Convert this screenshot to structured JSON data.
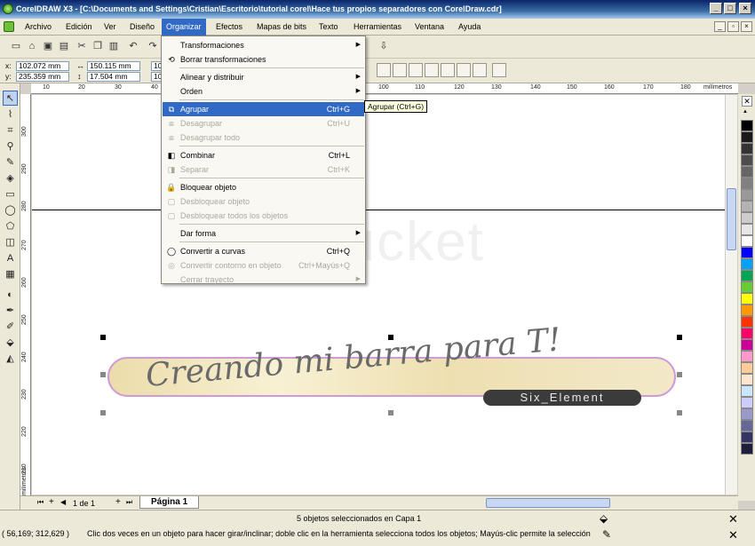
{
  "window": {
    "title": "CorelDRAW X3 - [C:\\Documents and Settings\\Cristian\\Escritorio\\tutorial corel\\Hace tus propios separadores con CorelDraw.cdr]",
    "minimize": "_",
    "maximize": "□",
    "close": "×"
  },
  "menubar": {
    "items": [
      "Archivo",
      "Edición",
      "Ver",
      "Diseño",
      "Organizar",
      "Efectos",
      "Mapas de bits",
      "Texto",
      "Herramientas",
      "Ventana",
      "Ayuda"
    ],
    "active": "Organizar"
  },
  "propbar": {
    "x_label": "x:",
    "x_value": "102.072 mm",
    "y_label": "y:",
    "y_value": "235.359 mm",
    "w_value": "150.115 mm",
    "h_value": "17.504 mm",
    "scale_x": "10",
    "scale_y": "10"
  },
  "organizar_menu": {
    "items": [
      {
        "label": "Transformaciones",
        "shortcut": "",
        "submenu": true,
        "disabled": false,
        "highlighted": false,
        "icon": ""
      },
      {
        "label": "Borrar transformaciones",
        "shortcut": "",
        "submenu": false,
        "disabled": false,
        "highlighted": false,
        "icon": "clear-transform-icon"
      },
      {
        "label": "Alinear y distribuir",
        "shortcut": "",
        "submenu": true,
        "disabled": false,
        "highlighted": false,
        "icon": ""
      },
      {
        "label": "Orden",
        "shortcut": "",
        "submenu": true,
        "disabled": false,
        "highlighted": false,
        "icon": ""
      },
      {
        "label": "Agrupar",
        "shortcut": "Ctrl+G",
        "submenu": false,
        "disabled": false,
        "highlighted": true,
        "icon": "group-icon"
      },
      {
        "label": "Desagrupar",
        "shortcut": "Ctrl+U",
        "submenu": false,
        "disabled": true,
        "highlighted": false,
        "icon": "ungroup-icon"
      },
      {
        "label": "Desagrupar todo",
        "shortcut": "",
        "submenu": false,
        "disabled": true,
        "highlighted": false,
        "icon": "ungroup-all-icon"
      },
      {
        "label": "Combinar",
        "shortcut": "Ctrl+L",
        "submenu": false,
        "disabled": false,
        "highlighted": false,
        "icon": "combine-icon"
      },
      {
        "label": "Separar",
        "shortcut": "Ctrl+K",
        "submenu": false,
        "disabled": true,
        "highlighted": false,
        "icon": "break-apart-icon"
      },
      {
        "label": "Bloquear objeto",
        "shortcut": "",
        "submenu": false,
        "disabled": false,
        "highlighted": false,
        "icon": "lock-icon"
      },
      {
        "label": "Desbloquear objeto",
        "shortcut": "",
        "submenu": false,
        "disabled": true,
        "highlighted": false,
        "icon": "unlock-icon"
      },
      {
        "label": "Desbloquear todos los objetos",
        "shortcut": "",
        "submenu": false,
        "disabled": true,
        "highlighted": false,
        "icon": "unlock-all-icon"
      },
      {
        "label": "Dar forma",
        "shortcut": "",
        "submenu": true,
        "disabled": false,
        "highlighted": false,
        "icon": ""
      },
      {
        "label": "Convertir a curvas",
        "shortcut": "Ctrl+Q",
        "submenu": false,
        "disabled": false,
        "highlighted": false,
        "icon": "convert-curves-icon"
      },
      {
        "label": "Convertir contorno en objeto",
        "shortcut": "Ctrl+Mayús+Q",
        "submenu": false,
        "disabled": true,
        "highlighted": false,
        "icon": "outline-object-icon"
      },
      {
        "label": "Cerrar trayecto",
        "shortcut": "",
        "submenu": true,
        "disabled": true,
        "highlighted": false,
        "icon": ""
      }
    ]
  },
  "tooltip": "Agrupar (Ctrl+G)",
  "rulers": {
    "h_labels": [
      "10",
      "20",
      "30",
      "40",
      "100",
      "110",
      "120",
      "130",
      "140",
      "150",
      "160",
      "170",
      "180"
    ],
    "h_unit": "milímetros",
    "v_labels": [
      "300",
      "290",
      "280",
      "270",
      "260",
      "250",
      "240",
      "230",
      "220",
      "210"
    ],
    "v_unit": "milímetros"
  },
  "canvas": {
    "banner_text": "Creando mi barra para T!",
    "banner_subtext": "Six_Element",
    "watermark": "photobucket"
  },
  "page_nav": {
    "count": "1 de 1",
    "tab": "Página 1"
  },
  "status": {
    "selection": "5 objetos seleccionados en Capa 1",
    "coords": "( 56,169; 312,629 )",
    "hint": "Clic dos veces en un objeto para hacer girar/inclinar; doble clic en la herramienta selecciona todos los objetos; Mayús-clic permite la selección ..."
  },
  "palette_colors": [
    "#000000",
    "#1a1a1a",
    "#333333",
    "#4d4d4d",
    "#666666",
    "#808080",
    "#999999",
    "#b3b3b3",
    "#cccccc",
    "#e6e6e6",
    "#ffffff",
    "#0000ff",
    "#00a0ff",
    "#00a651",
    "#66cc33",
    "#ffff00",
    "#ff9900",
    "#ff3300",
    "#ff0066",
    "#cc0099",
    "#ff99cc",
    "#ffcc99",
    "#ffe5cc",
    "#cce5ff",
    "#ccccff",
    "#9999cc",
    "#666699",
    "#333366",
    "#1e1e3c"
  ]
}
